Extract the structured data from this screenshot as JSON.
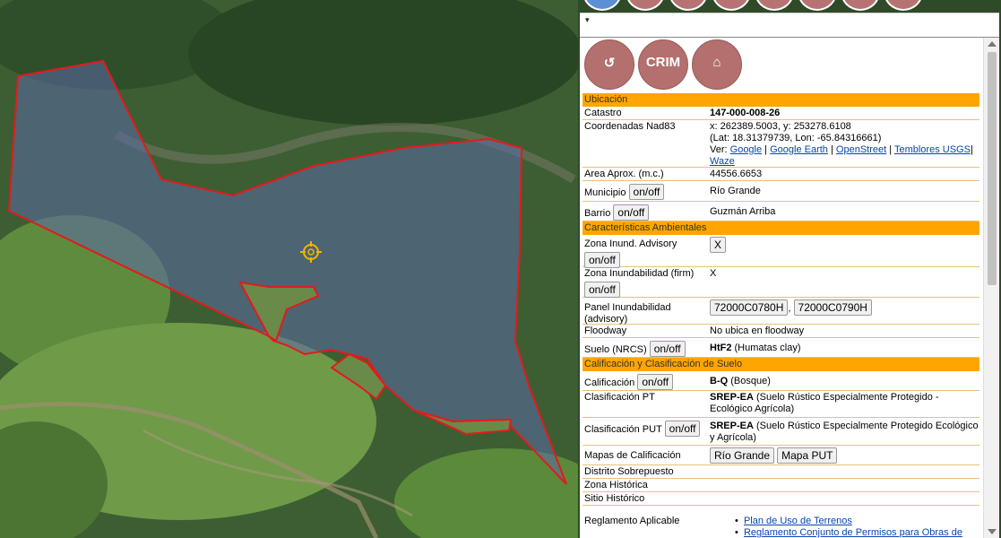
{
  "panel": {
    "caret": "▾",
    "icons": [
      {
        "name": "ocpr-icon",
        "color": "#b3706e"
      },
      {
        "name": "crim-logo",
        "color": "#b3706e"
      },
      {
        "name": "house-flood-icon",
        "color": "#b3706e"
      }
    ],
    "sections": {
      "ubicacion": "Ubicación",
      "ambientales": "Características Ambientales",
      "calificacion": "Calificación y Clasificación de Suelo"
    },
    "toggle_label": "on/off",
    "catastro_label": "Catastro",
    "catastro_value": "147-000-008-26",
    "coord_label": "Coordenadas Nad83",
    "coord_xy": "x: 262389.5003, y: 253278.6108",
    "coord_latlon": "(Lat: 18.31379739, Lon: -65.84316661)",
    "ver_label": "Ver:",
    "links": {
      "google": "Google",
      "earth": "Google Earth",
      "osm": "OpenStreet",
      "temblores": "Temblores USGS",
      "waze": "Waze"
    },
    "area_label": "Area Aprox. (m.c.)",
    "area_value": "44556.6653",
    "municipio_label": "Municipio",
    "municipio_value": "Río Grande",
    "barrio_label": "Barrio",
    "barrio_value": "Guzmán Arriba",
    "zona_adv_label": "Zona Inund. Advisory",
    "zona_adv_value": "X",
    "zona_firm_label": "Zona Inundabilidad (firm)",
    "zona_firm_value": "X",
    "panel_label": "Panel Inundabilidad (advisory)",
    "panel_values": [
      "72000C0780H",
      "72000C0790H"
    ],
    "floodway_label": "Floodway",
    "floodway_value": "No ubica en floodway",
    "suelo_label": "Suelo (NRCS)",
    "suelo_code": "HtF2",
    "suelo_desc": "(Humatas clay)",
    "calif_label": "Calificación",
    "calif_code": "B-Q",
    "calif_desc": "(Bosque)",
    "pt_label": "Clasificación PT",
    "pt_code": "SREP-EA",
    "pt_desc": "(Suelo Rústico Especialmente Protegido - Ecológico Agrícola)",
    "put_label": "Clasificación PUT",
    "put_code": "SREP-EA",
    "put_desc": "(Suelo Rústico Especialmente Protegido Ecológico y Agrícola)",
    "mapas_label": "Mapas de Calificación",
    "mapas_buttons": [
      "Río Grande",
      "Mapa PUT"
    ],
    "distrito_label": "Distrito Sobrepuesto",
    "zona_hist_label": "Zona Histórica",
    "sitio_hist_label": "Sitio Histórico",
    "reglamento_label": "Reglamento Aplicable",
    "reglamento_links": [
      "Plan de Uso de Terrenos",
      "Reglamento Conjunto de Permisos para Obras de"
    ]
  },
  "colors": {
    "section": "#ffa500",
    "parcel": "#e41a1c",
    "link": "#0645ad"
  }
}
